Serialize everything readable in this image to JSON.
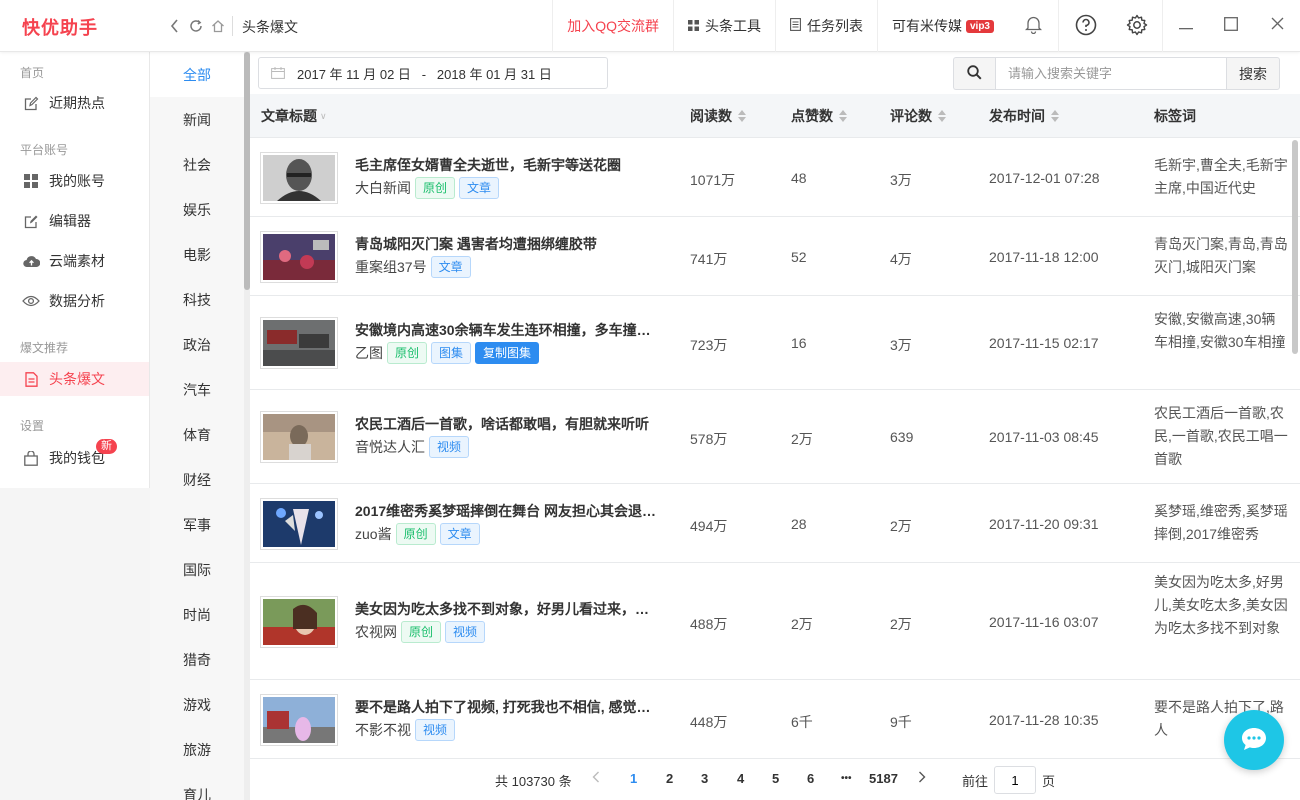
{
  "app": {
    "brand": "快优助手",
    "crumb": "头条爆文"
  },
  "topbar": {
    "qq": "加入QQ交流群",
    "tools": "头条工具",
    "tasks": "任务列表",
    "account": "可有米传媒",
    "vip": "vip3"
  },
  "sidebar": {
    "sec_home": "首页",
    "hot": "近期热点",
    "sec_platform": "平台账号",
    "my_account": "我的账号",
    "editor": "编辑器",
    "cloud": "云端素材",
    "analytics": "数据分析",
    "sec_recommend": "爆文推荐",
    "toutiao": "头条爆文",
    "sec_settings": "设置",
    "wallet": "我的钱包",
    "wallet_badge": "新"
  },
  "categories": [
    "全部",
    "新闻",
    "社会",
    "娱乐",
    "电影",
    "科技",
    "政治",
    "汽车",
    "体育",
    "财经",
    "军事",
    "国际",
    "时尚",
    "猎奇",
    "游戏",
    "旅游",
    "育儿"
  ],
  "filters": {
    "date_range": "2017 年 11 月 02 日   -   2018 年 01 月 31 日",
    "search_placeholder": "请输入搜索关键字",
    "search_button": "搜索"
  },
  "table": {
    "headers": {
      "title": "文章标题",
      "reads": "阅读数",
      "likes": "点赞数",
      "comments": "评论数",
      "published": "发布时间",
      "tags": "标签词"
    },
    "rows": [
      {
        "title": "毛主席侄女婿曹全夫逝世，毛新宇等送花圈",
        "source": "大白新闻",
        "badges": [
          "原创",
          "文章"
        ],
        "reads": "1071万",
        "likes": "48",
        "comments": "3万",
        "published": "2017-12-01 07:28",
        "tags": "毛新宇,曹全夫,毛新宇主席,中国近代史"
      },
      {
        "title": "青岛城阳灭门案 遇害者均遭捆绑缠胶带",
        "source": "重案组37号",
        "badges": [
          "文章"
        ],
        "reads": "741万",
        "likes": "52",
        "comments": "4万",
        "published": "2017-11-18 12:00",
        "tags": "青岛灭门案,青岛,青岛灭门,城阳灭门案"
      },
      {
        "title": "安徽境内高速30余辆车发生连环相撞，多车撞…",
        "source": "乙图",
        "badges": [
          "原创",
          "图集",
          "复制图集"
        ],
        "reads": "723万",
        "likes": "16",
        "comments": "3万",
        "published": "2017-11-15 02:17",
        "tags": "安徽,安徽高速,30辆车相撞,安徽30车相撞"
      },
      {
        "title": "农民工酒后一首歌，啥话都敢唱，有胆就来听听",
        "source": "音悦达人汇",
        "badges": [
          "视频"
        ],
        "reads": "578万",
        "likes": "2万",
        "comments": "639",
        "published": "2017-11-03 08:45",
        "tags": "农民工酒后一首歌,农民,一首歌,农民工唱一首歌"
      },
      {
        "title": "2017维密秀奚梦瑶摔倒在舞台 网友担心其会退…",
        "source": "zuo酱",
        "badges": [
          "原创",
          "文章"
        ],
        "reads": "494万",
        "likes": "28",
        "comments": "2万",
        "published": "2017-11-20 09:31",
        "tags": "奚梦瑶,维密秀,奚梦瑶摔倒,2017维密秀"
      },
      {
        "title": "美女因为吃太多找不到对象，好男儿看过来，…",
        "source": "农视网",
        "badges": [
          "原创",
          "视频"
        ],
        "reads": "488万",
        "likes": "2万",
        "comments": "2万",
        "published": "2017-11-16 03:07",
        "tags": "美女因为吃太多,好男儿,美女吃太多,美女因为吃太多找不到对象"
      },
      {
        "title": "要不是路人拍下了视频, 打死我也不相信, 感觉…",
        "source": "不影不视",
        "badges": [
          "视频"
        ],
        "reads": "448万",
        "likes": "6千",
        "comments": "9千",
        "published": "2017-11-28 10:35",
        "tags": "要不是路人拍下了,路人"
      }
    ]
  },
  "pager": {
    "total": "共 103730 条",
    "pages": [
      "1",
      "2",
      "3",
      "4",
      "5",
      "6"
    ],
    "ellipsis": "•••",
    "last": "5187",
    "goto_label": "前往",
    "goto_value": "1",
    "goto_unit": "页"
  },
  "colors": {
    "brand": "#f5434f",
    "accent": "#2d8cf0",
    "fab": "#1ec6e6"
  }
}
